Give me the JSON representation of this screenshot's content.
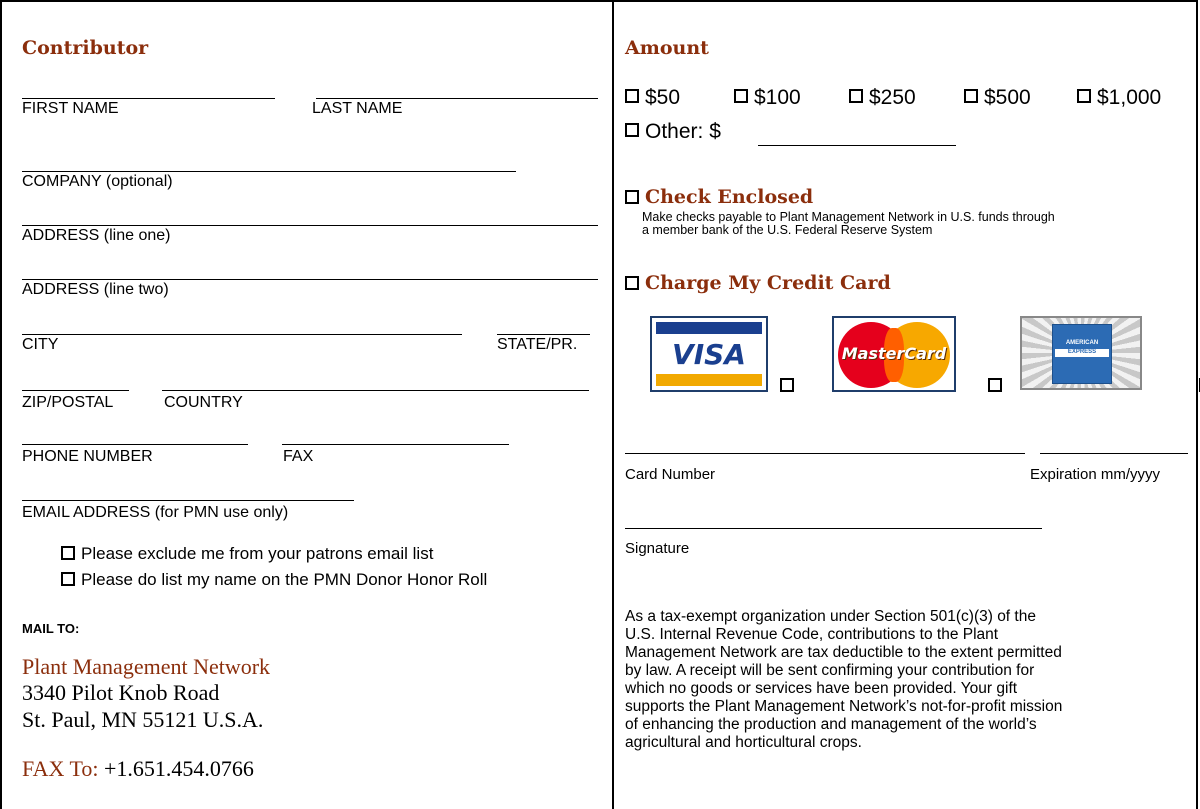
{
  "contributor": {
    "heading": "Contributor",
    "fields": {
      "first_name": "FIRST NAME",
      "last_name": "LAST NAME",
      "company": "COMPANY (optional)",
      "address1": "ADDRESS (line one)",
      "address2": "ADDRESS (line two)",
      "city": "CITY",
      "state": "STATE/PR.",
      "zip": "ZIP/POSTAL",
      "country": "COUNTRY",
      "phone": "PHONE NUMBER",
      "fax": "FAX",
      "email": "EMAIL ADDRESS (for PMN use only)"
    },
    "options": [
      "Please exclude me from your patrons email list",
      "Please do list my name on the PMN Donor Honor Roll"
    ],
    "mail_to_label": "MAIL TO:",
    "org_name": "Plant Management Network",
    "street": "3340 Pilot Knob Road",
    "city_line": "St. Paul, MN 55121 U.S.A.",
    "fax_label": "FAX To:",
    "fax_number": "+1.651.454.0766"
  },
  "amount": {
    "heading": "Amount",
    "options": [
      "$50",
      "$100",
      "$250",
      "$500",
      "$1,000"
    ],
    "other_label": "Other:  $",
    "check_heading": "Check Enclosed",
    "check_note_1": "Make checks payable to Plant Management Network in U.S. funds through",
    "check_note_2": "a member bank of the U.S. Federal Reserve System",
    "card_heading": "Charge My Credit Card",
    "cards": {
      "visa": "VISA",
      "mastercard": "MasterCard",
      "amex_line1": "AMERICAN",
      "amex_line2": "EXPRESS"
    },
    "card_number_label": "Card Number",
    "expiration_label": "Expiration mm/yyyy",
    "signature_label": "Signature",
    "tax_text": [
      "As a tax-exempt organization under Section 501(c)(3) of the",
      "U.S. Internal Revenue Code, contributions to the Plant",
      "Management Network are tax deductible to the extent permitted",
      "by law. A receipt will be sent confirming your contribution for",
      "which no goods or services have been provided. Your gift",
      "supports the Plant Management Network’s not-for-profit mission",
      "of enhancing the production and management of the world’s",
      "agricultural and horticultural crops."
    ]
  },
  "colors": {
    "heading": "#8b2e0c",
    "visa_blue": "#1a3f8f",
    "visa_gold": "#f2a900",
    "mc_red": "#e5001c",
    "mc_yellow": "#f7a800",
    "amex_blue": "#2c6bb4"
  }
}
